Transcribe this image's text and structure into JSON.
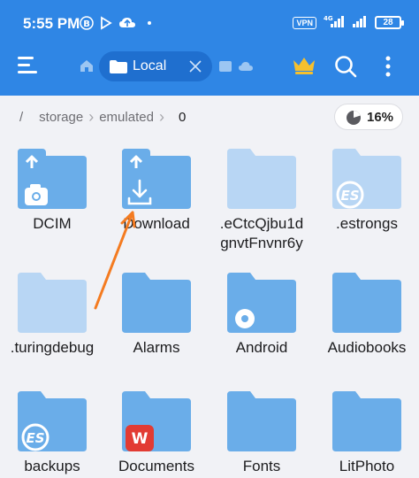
{
  "status": {
    "time": "5:55 PM",
    "vpn": "VPN",
    "network": "4G",
    "battery": "28"
  },
  "toolbar": {
    "tab_label": "Local"
  },
  "breadcrumb": [
    "/",
    "storage",
    "emulated",
    "0"
  ],
  "storage_usage": "16%",
  "colors": {
    "primary": "#2f86e5",
    "tab_pill": "#1f6fcf",
    "folder": "#6aade9",
    "folder_light": "#b8d6f4",
    "arrow": "#f47b20"
  },
  "folders": [
    {
      "name": "DCIM",
      "badge": "upload",
      "overlay": "camera-icon",
      "hidden": false
    },
    {
      "name": "Download",
      "badge": "upload",
      "overlay": "download-icon",
      "hidden": false
    },
    {
      "name": ".eCtcQjbu1d gnvtFnvnr6y",
      "badge": "",
      "overlay": "",
      "hidden": true
    },
    {
      "name": ".estrongs",
      "badge": "",
      "overlay": "es-logo-icon",
      "hidden": true
    },
    {
      "name": ".turingdebug",
      "badge": "",
      "overlay": "",
      "hidden": true
    },
    {
      "name": "Alarms",
      "badge": "",
      "overlay": "",
      "hidden": false
    },
    {
      "name": "Android",
      "badge": "",
      "overlay": "gear-icon",
      "hidden": false
    },
    {
      "name": "Audiobooks",
      "badge": "",
      "overlay": "",
      "hidden": false
    },
    {
      "name": "backups",
      "badge": "",
      "overlay": "es-logo-icon",
      "hidden": false
    },
    {
      "name": "Documents",
      "badge": "",
      "overlay": "wps-icon",
      "hidden": false
    },
    {
      "name": "Fonts",
      "badge": "",
      "overlay": "",
      "hidden": false
    },
    {
      "name": "LitPhoto",
      "badge": "",
      "overlay": "",
      "hidden": false
    }
  ]
}
